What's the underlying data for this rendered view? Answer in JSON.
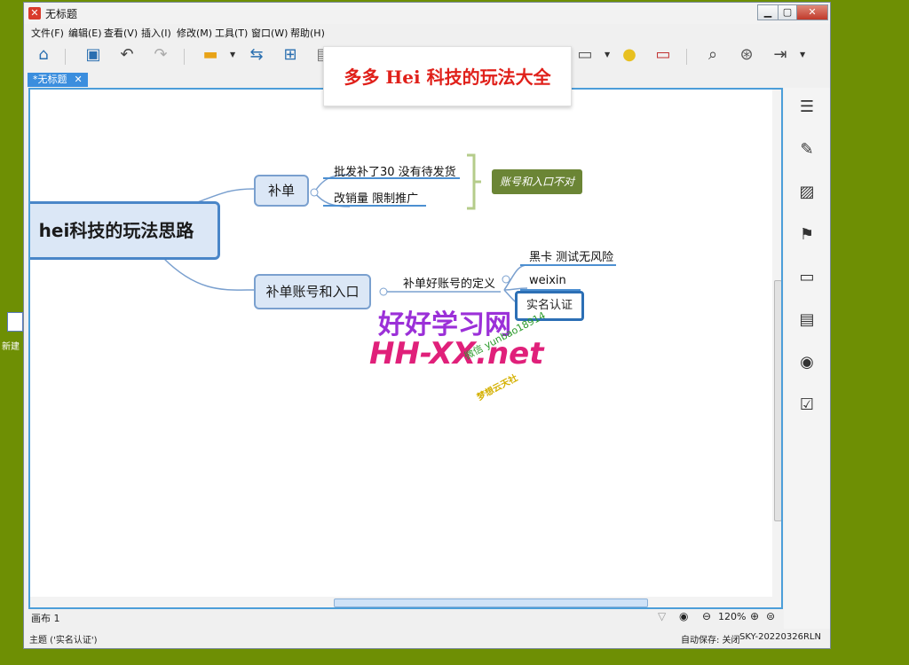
{
  "window": {
    "title": "无标题",
    "controls": [
      "minimize",
      "maximize",
      "close"
    ]
  },
  "menu": [
    "文件(F)",
    "编辑(E)",
    "查看(V)",
    "插入(I)",
    "修改(M)",
    "工具(T)",
    "窗口(W)",
    "帮助(H)"
  ],
  "toolbar": {
    "home": "home-icon",
    "save": "save-icon",
    "undo": "undo-icon",
    "redo": "redo-icon"
  },
  "tab": {
    "label": "*无标题",
    "close": "✕"
  },
  "banner": {
    "text": "多多 Hei 科技的玩法大全"
  },
  "mindmap": {
    "central": "hei科技的玩法思路",
    "branch1": {
      "label": "补单",
      "items": [
        "批发补了30  没有待发货",
        "改销量  限制推广"
      ],
      "summary": "账号和入口不对"
    },
    "branch2": {
      "label": "补单账号和入口",
      "sub": "补单好账号的定义",
      "items": [
        "黑卡 测试无风险",
        "weixin",
        "实名认证"
      ]
    }
  },
  "watermark": {
    "line1": "好好学习网",
    "line2": "HH-XX.net",
    "small1": "微信 yunbao18914",
    "small2": "梦想云天社"
  },
  "sheet": {
    "label": "画布 1",
    "zoom": "120%"
  },
  "status": {
    "left": "主题 ('实名认证')",
    "autosave": "自动保存: 关闭",
    "machine": "SKY-20220326RLN"
  },
  "desktop": {
    "label": "新建 D"
  }
}
